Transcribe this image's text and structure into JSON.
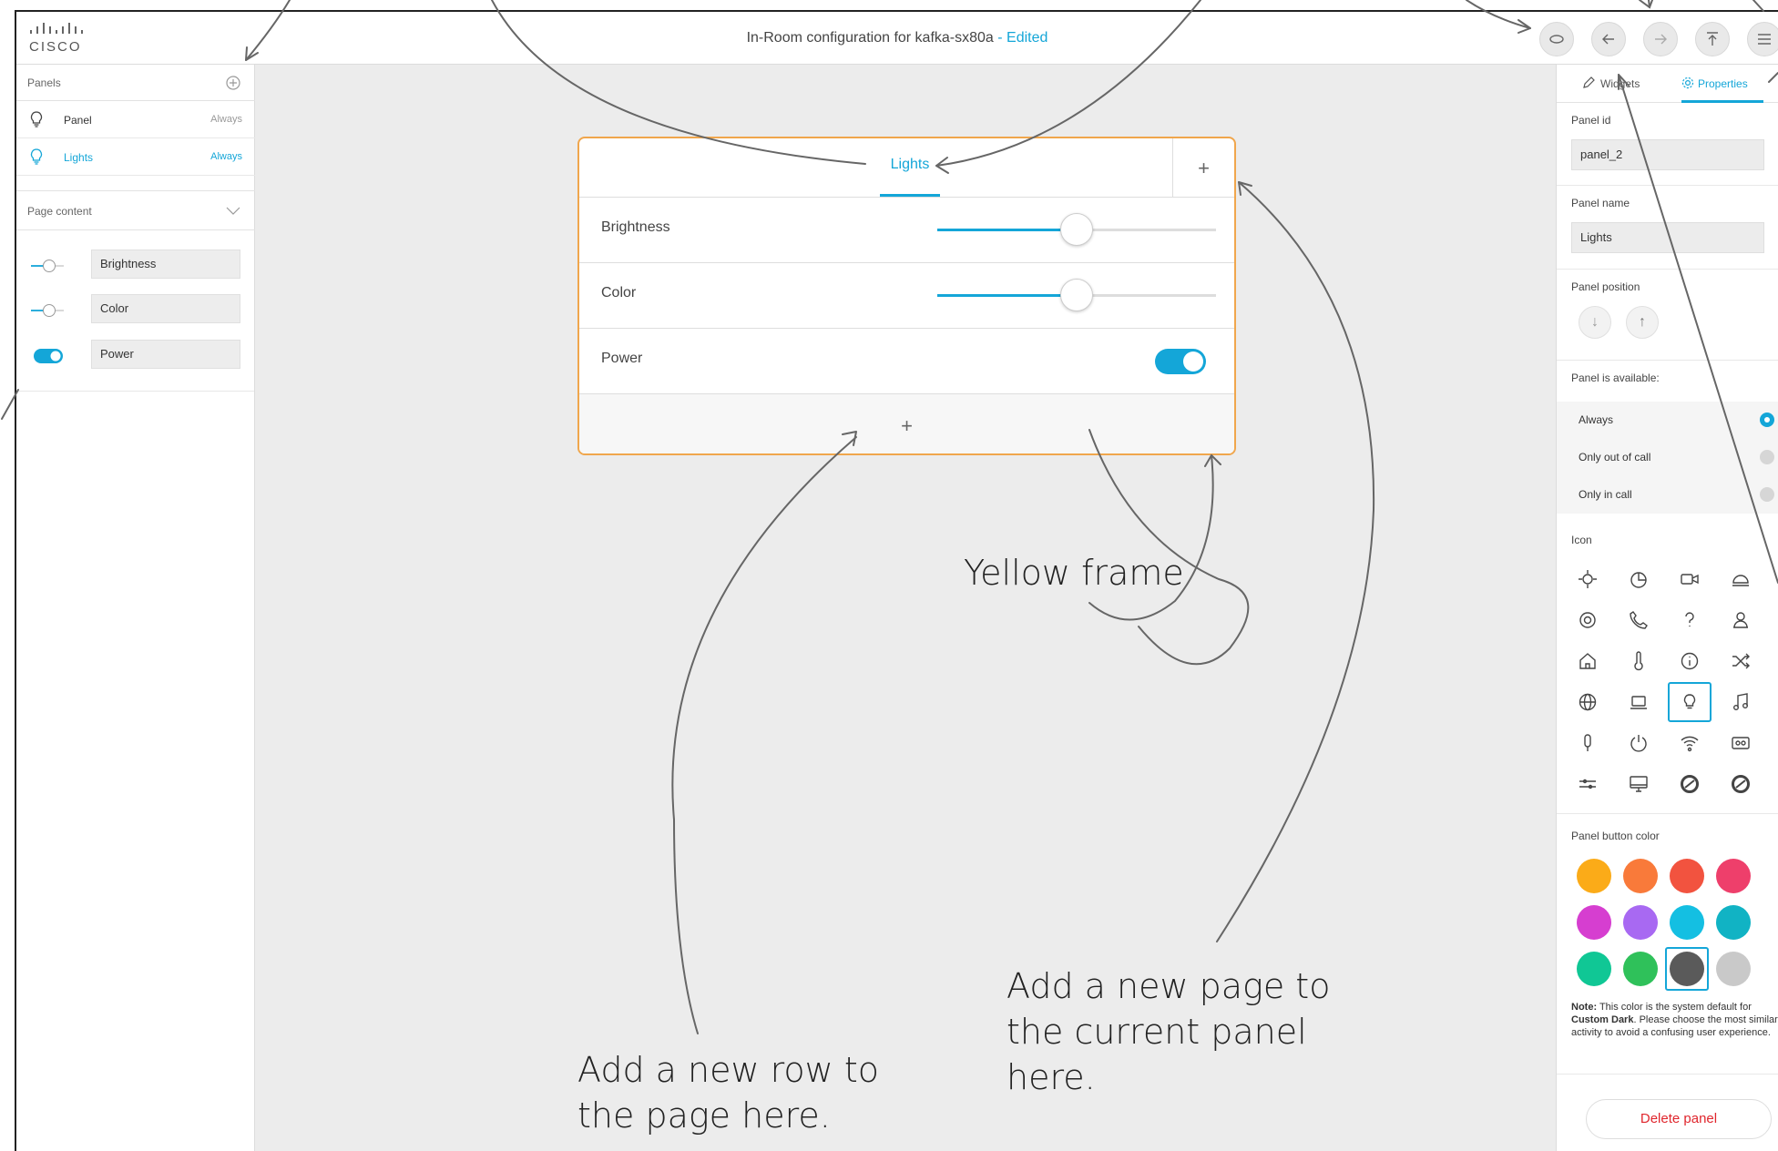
{
  "app": {
    "logo_text": "CISCO",
    "title": "In-Room configuration for kafka-sx80a",
    "title_suffix": " - Edited",
    "accent_color": "#14a6d8",
    "frame_color": "#f0a64c",
    "toolbar_icons": [
      "preview-icon",
      "undo-icon",
      "redo-icon",
      "export-icon",
      "menu-icon"
    ]
  },
  "sidebar": {
    "panels_heading": "Panels",
    "panels": [
      {
        "name": "Panel",
        "availability": "Always",
        "selected": false
      },
      {
        "name": "Lights",
        "availability": "Always",
        "selected": true
      }
    ],
    "page_content_heading": "Page content",
    "widgets": [
      {
        "type": "slider",
        "name": "Brightness"
      },
      {
        "type": "slider",
        "name": "Color"
      },
      {
        "type": "toggle",
        "name": "Power"
      }
    ]
  },
  "canvas": {
    "tab_label": "Lights",
    "rows": [
      {
        "label": "Brightness",
        "type": "slider",
        "value": 0.5
      },
      {
        "label": "Color",
        "type": "slider",
        "value": 0.5
      },
      {
        "label": "Power",
        "type": "toggle",
        "on": true
      }
    ]
  },
  "properties": {
    "tabs": {
      "widgets": "Widgets",
      "properties": "Properties"
    },
    "panel_id_label": "Panel id",
    "panel_id_value": "panel_2",
    "panel_name_label": "Panel name",
    "panel_name_value": "Lights",
    "panel_position_label": "Panel position",
    "availability_label": "Panel is available:",
    "availability_options": [
      "Always",
      "Only out of call",
      "Only in call"
    ],
    "availability_selected": "Always",
    "icon_label": "Icon",
    "icons": [
      "brightness-icon",
      "timer-icon",
      "camera-icon",
      "dome-light-icon",
      "target-icon",
      "phone-icon",
      "help-icon",
      "concierge-icon",
      "home-icon",
      "thermometer-icon",
      "info-icon",
      "shuffle-icon",
      "globe-icon",
      "laptop-icon",
      "lightbulb-icon",
      "music-note-icon",
      "microphone-icon",
      "power-icon",
      "wifi-icon",
      "tape-icon",
      "sliders-icon",
      "monitor-icon",
      "disc-icon",
      "disc-icon"
    ],
    "icon_selected": "lightbulb-icon",
    "color_label": "Panel button color",
    "colors": [
      "#fbab18",
      "#f97a3a",
      "#f2533f",
      "#ee3f6b",
      "#d63ed0",
      "#a869f2",
      "#14bfe2",
      "#11b3c4",
      "#10c795",
      "#2fc15a",
      "#5a5a5a",
      "#c9c9c9"
    ],
    "color_selected": "#5a5a5a",
    "note_label": "Note:",
    "note_text": " This color is the system default for ",
    "note_bold": "Custom Dark",
    "note_tail": ". Please choose the most similar activity to avoid a confusing user experience.",
    "delete_label": "Delete panel"
  },
  "annotations": {
    "yellow_frame": "Yellow frame",
    "new_row": "Add a new row to the page here.",
    "new_page": "Add a new page to the current panel here."
  }
}
